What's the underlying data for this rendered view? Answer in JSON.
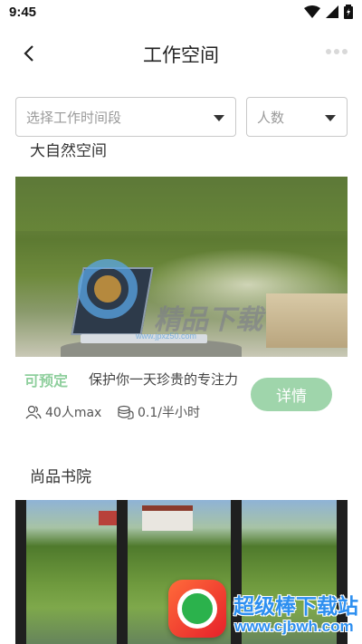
{
  "status_bar": {
    "time": "9:45"
  },
  "header": {
    "title": "工作空间"
  },
  "filters": {
    "time_placeholder": "选择工作时间段",
    "people_placeholder": "人数"
  },
  "cards": [
    {
      "title": "大自然空间",
      "status": "可预定",
      "description": "保护你一天珍贵的专注力",
      "detail_label": "详情",
      "capacity": "40人max",
      "price": "0.1/半小时",
      "watermark_text": "精品下载",
      "watermark_url": "www.jpxz50.com"
    },
    {
      "title": "尚品书院"
    }
  ],
  "app_badge": {
    "name": "超级棒下载站",
    "url": "www.cjbwh.com"
  },
  "colors": {
    "accent_green": "#9fd5ab",
    "available_green": "#8fcf9d",
    "badge_blue": "#2d8ff0"
  }
}
